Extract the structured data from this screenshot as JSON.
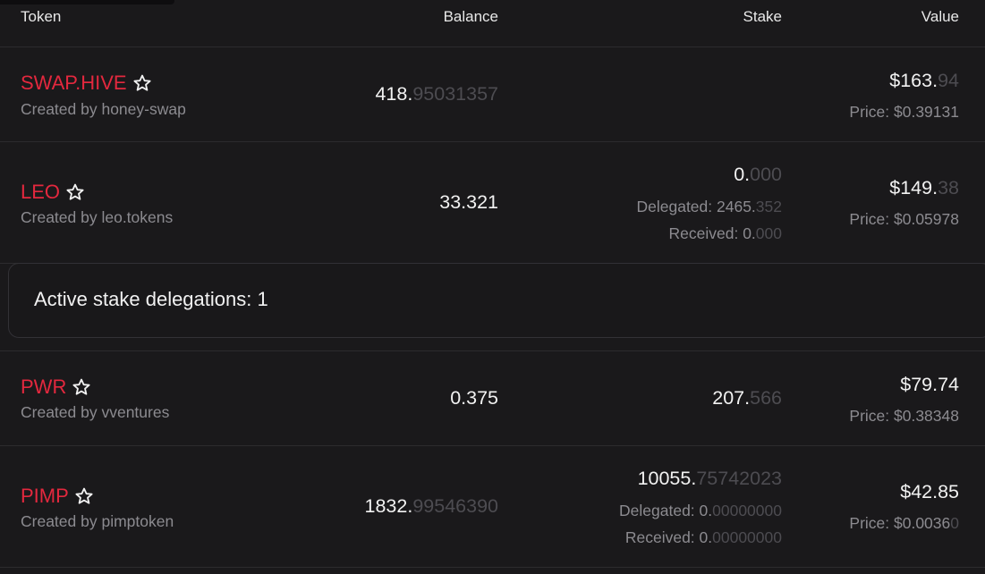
{
  "header": {
    "token": "Token",
    "balance": "Balance",
    "stake": "Stake",
    "value": "Value"
  },
  "rows": [
    {
      "symbol": "SWAP.HIVE",
      "creator": "Created by honey-swap",
      "balance_int": "418.",
      "balance_dec": "95031357",
      "value_int": "$163.",
      "value_dec": "94",
      "price": "Price: $0.39131"
    },
    {
      "symbol": "LEO",
      "creator": "Created by leo.tokens",
      "balance_int": "33.321",
      "stake_int": "0.",
      "stake_dec": "000",
      "delegated_int": "Delegated: 2465.",
      "delegated_dec": "352",
      "received_int": "Received: 0.",
      "received_dec": "000",
      "value_int": "$149.",
      "value_dec": "38",
      "price": "Price: $0.05978"
    },
    {
      "symbol": "PWR",
      "creator": "Created by vventures",
      "balance_int": "0.375",
      "stake_int": "207.",
      "stake_dec": "566",
      "value_int": "$79.74",
      "price": "Price: $0.38348"
    },
    {
      "symbol": "PIMP",
      "creator": "Created by pimptoken",
      "balance_int": "1832.",
      "balance_dec": "99546390",
      "stake_int": "10055.",
      "stake_dec": "75742023",
      "delegated_int": "Delegated: 0.",
      "delegated_dec": "00000000",
      "received_int": "Received: 0.",
      "received_dec": "00000000",
      "value_int": "$42.85",
      "price_int": "Price: $0.0036",
      "price_dec": "0"
    }
  ],
  "delegations": {
    "text": "Active stake delegations: 1"
  },
  "icons": {
    "favorite": "star-outline-icon"
  },
  "colors": {
    "symbol": "#e3283e",
    "background": "#1a191b",
    "muted": "#8c8b90",
    "faded_decimals": "#4d4c51"
  }
}
